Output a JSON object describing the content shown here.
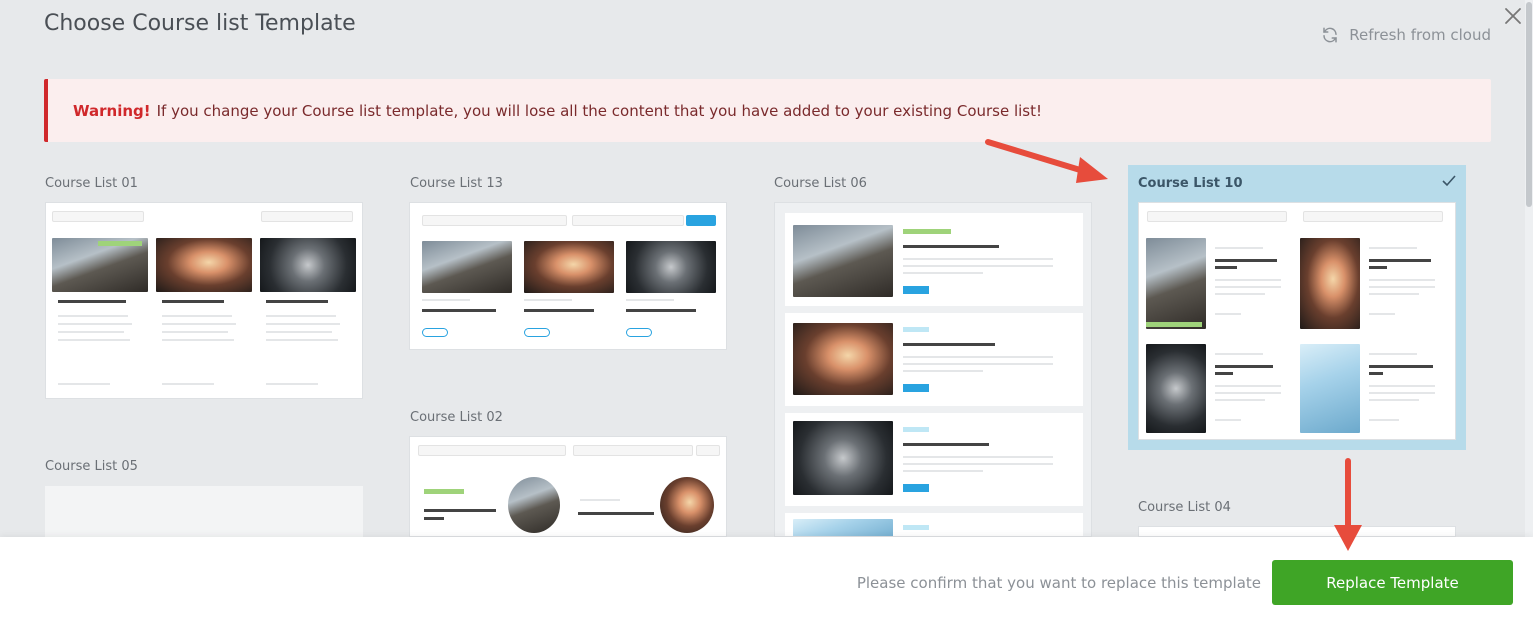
{
  "modal": {
    "title": "Choose Course list Template",
    "refresh_label": "Refresh from cloud"
  },
  "warning": {
    "label": "Warning!",
    "message": "If you change your Course list template, you will lose all the content that you have added to your existing Course list!"
  },
  "templates": [
    {
      "label": "Course List 01"
    },
    {
      "label": "Course List 13"
    },
    {
      "label": "Course List 06"
    },
    {
      "label": "Course List 10",
      "selected": true
    },
    {
      "label": "Course List 02"
    },
    {
      "label": "Course List 05"
    },
    {
      "label": "Course List 04"
    }
  ],
  "footer": {
    "confirm_text": "Please confirm that you want to replace this template",
    "replace_label": "Replace Template"
  },
  "colors": {
    "accent_green": "#3fa526",
    "warning_red": "#d0282b",
    "selection_blue": "#b7dbea",
    "arrow_red": "#e74c3c"
  }
}
